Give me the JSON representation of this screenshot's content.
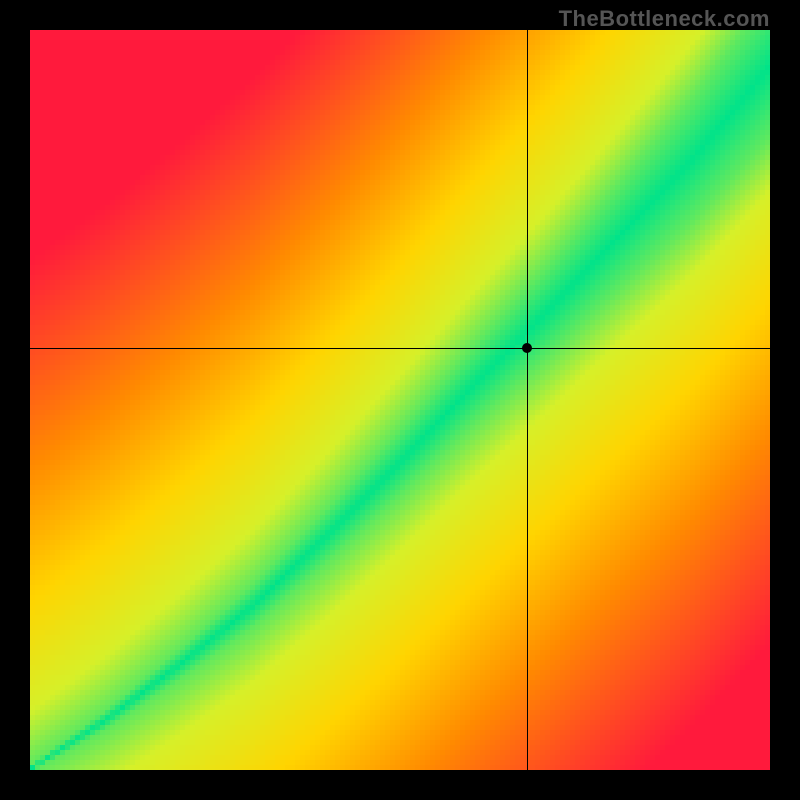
{
  "watermark": "TheBottleneck.com",
  "chart_data": {
    "type": "heatmap",
    "title": "",
    "xlabel": "",
    "ylabel": "",
    "xlim": [
      0,
      1
    ],
    "ylim": [
      0,
      1
    ],
    "marker": {
      "x": 0.671,
      "y": 0.57
    },
    "crosshair": {
      "x": 0.671,
      "y": 0.57
    },
    "optimal_band": {
      "description": "Green diagonal band of near-zero bottleneck; curves slightly, widening toward upper right",
      "center_line_points": [
        {
          "x": 0.0,
          "y": 0.0
        },
        {
          "x": 0.1,
          "y": 0.065
        },
        {
          "x": 0.2,
          "y": 0.14
        },
        {
          "x": 0.3,
          "y": 0.22
        },
        {
          "x": 0.4,
          "y": 0.315
        },
        {
          "x": 0.5,
          "y": 0.415
        },
        {
          "x": 0.6,
          "y": 0.52
        },
        {
          "x": 0.7,
          "y": 0.62
        },
        {
          "x": 0.8,
          "y": 0.725
        },
        {
          "x": 0.9,
          "y": 0.83
        },
        {
          "x": 1.0,
          "y": 0.95
        }
      ],
      "half_width_at": [
        {
          "x": 0.0,
          "w": 0.005
        },
        {
          "x": 0.25,
          "w": 0.025
        },
        {
          "x": 0.5,
          "w": 0.045
        },
        {
          "x": 0.75,
          "w": 0.065
        },
        {
          "x": 1.0,
          "w": 0.095
        }
      ]
    },
    "color_scale": {
      "best": "#00e38a",
      "good": "#d6f029",
      "mid": "#ffd400",
      "warn": "#ff8a00",
      "bad": "#ff1a3c"
    },
    "grid": false,
    "legend": false
  }
}
